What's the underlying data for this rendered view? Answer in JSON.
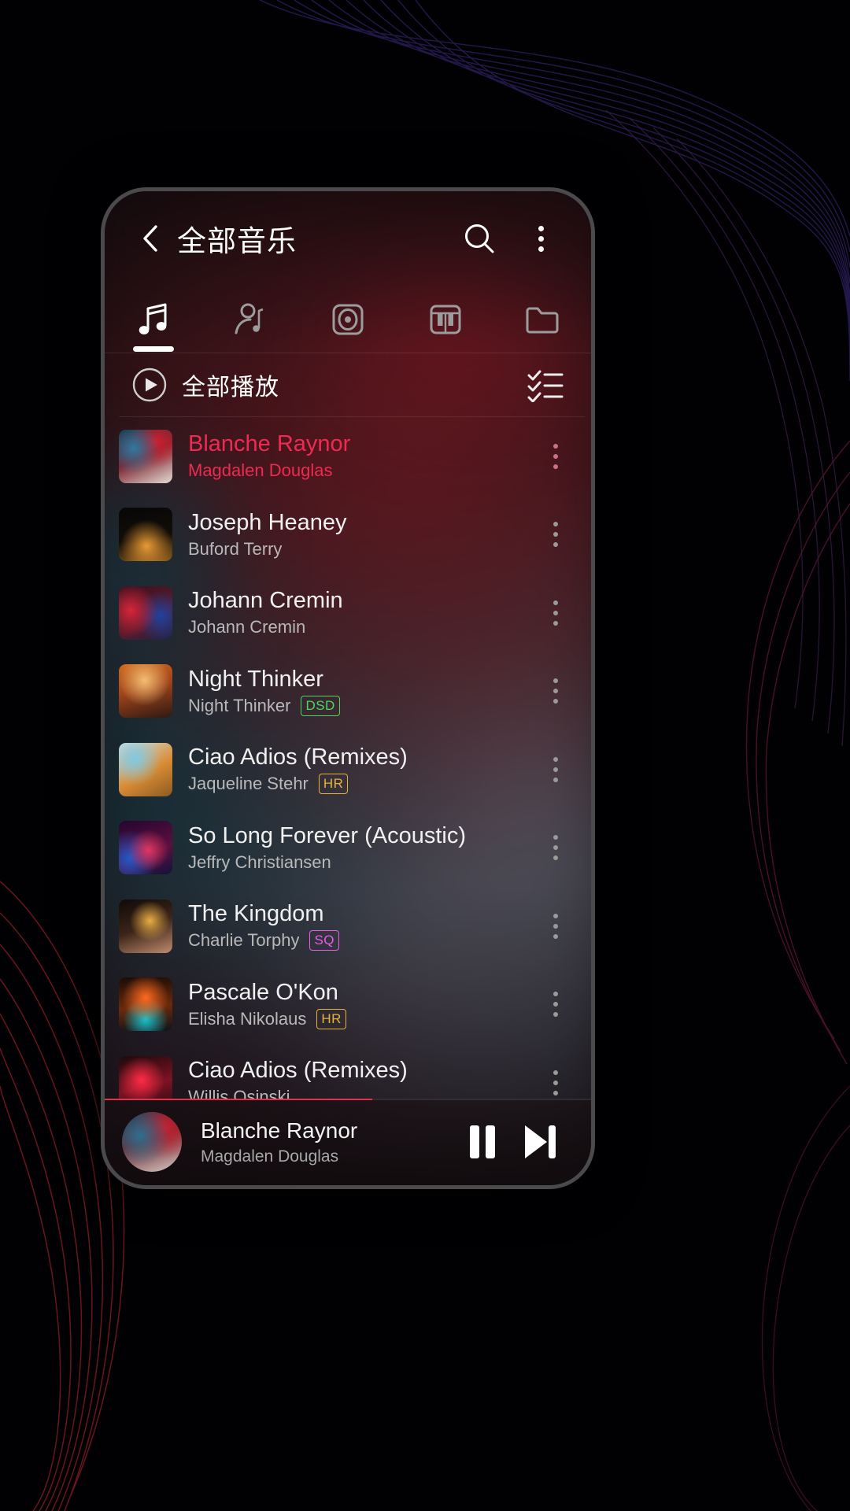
{
  "app": {
    "platform": "android-music-player"
  },
  "header": {
    "title": "全部音乐",
    "back_icon": "chevron-left-icon",
    "search_icon": "search-icon",
    "overflow_icon": "more-vertical-icon"
  },
  "tabs": [
    {
      "name": "songs",
      "icon": "music-note-icon",
      "active": true
    },
    {
      "name": "artists",
      "icon": "artist-note-icon",
      "active": false
    },
    {
      "name": "albums",
      "icon": "album-disc-icon",
      "active": false
    },
    {
      "name": "genres",
      "icon": "piano-keys-icon",
      "active": false
    },
    {
      "name": "folders",
      "icon": "folder-icon",
      "active": false
    }
  ],
  "playall": {
    "label": "全部播放",
    "play_icon": "play-circle-icon",
    "list_icon": "checklist-icon"
  },
  "tracks": [
    {
      "title": "Blanche Raynor",
      "artist": "Magdalen Douglas",
      "badge": "",
      "playing": true,
      "art": {
        "c1": "#1b2f46",
        "c2": "#b8232f",
        "c3": "#f0e6e2",
        "kind": "person-blue-red"
      }
    },
    {
      "title": "Joseph Heaney",
      "artist": "Buford Terry",
      "badge": "",
      "playing": false,
      "art": {
        "c1": "#0b0a0a",
        "c2": "#d98a2b",
        "c3": "#2a1c10",
        "kind": "dark-amber"
      }
    },
    {
      "title": "Johann Cremin",
      "artist": "Johann Cremin",
      "badge": "",
      "playing": false,
      "art": {
        "c1": "#3a1020",
        "c2": "#d32a3a",
        "c3": "#1d2f5c",
        "kind": "portrait-red-blue"
      }
    },
    {
      "title": "Night Thinker",
      "artist": "Night Thinker",
      "badge": "DSD",
      "playing": false,
      "art": {
        "c1": "#c0621f",
        "c2": "#f0b46a",
        "c3": "#2b1a12",
        "kind": "warm-stage"
      }
    },
    {
      "title": "Ciao Adios (Remixes)",
      "artist": "Jaqueline Stehr",
      "badge": "HR",
      "playing": false,
      "art": {
        "c1": "#cf8a3a",
        "c2": "#5fb8d8",
        "c3": "#e9d9c4",
        "kind": "orange-suit"
      }
    },
    {
      "title": "So Long Forever (Acoustic)",
      "artist": "Jeffry Christiansen",
      "badge": "",
      "playing": false,
      "art": {
        "c1": "#2a0f3a",
        "c2": "#d8335e",
        "c3": "#1b4fa0",
        "kind": "concert-purple"
      }
    },
    {
      "title": "The Kingdom",
      "artist": "Charlie Torphy",
      "badge": "SQ",
      "playing": false,
      "art": {
        "c1": "#140d0c",
        "c2": "#e0a63c",
        "c3": "#c88a6e",
        "kind": "portrait-gold"
      }
    },
    {
      "title": "Pascale O'Kon",
      "artist": "Elisha Nikolaus",
      "badge": "HR",
      "playing": false,
      "art": {
        "c1": "#1a0c08",
        "c2": "#ff5a14",
        "c3": "#12b8c8",
        "kind": "neon-chevron"
      }
    },
    {
      "title": "Ciao Adios (Remixes)",
      "artist": "Willis Osinski",
      "badge": "",
      "playing": false,
      "art": {
        "c1": "#1a0a0c",
        "c2": "#ff2b46",
        "c3": "#6a1220",
        "kind": "neon-bar"
      }
    }
  ],
  "row_menu_icon": "more-vertical-icon",
  "now_playing": {
    "title": "Blanche Raynor",
    "artist": "Magdalen Douglas",
    "pause_icon": "pause-icon",
    "next_icon": "skip-next-icon",
    "progress_percent": 55
  },
  "colors": {
    "accent": "#ef2a52",
    "badge_dsd": "#49d764",
    "badge_hr": "#e8b13c",
    "badge_sq": "#ee5bea",
    "progress": "#e0314f"
  }
}
